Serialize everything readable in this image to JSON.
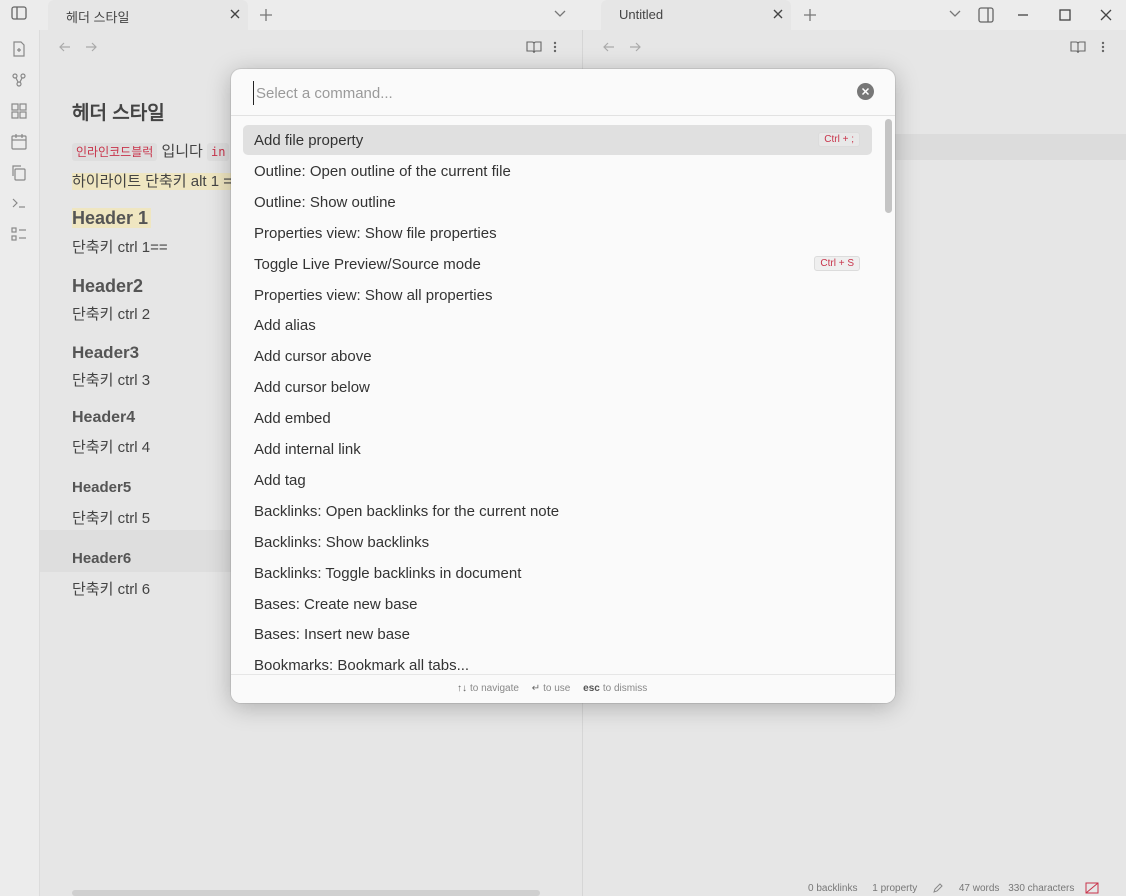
{
  "left_pane": {
    "tab_title": "헤더 스타일",
    "document": {
      "title": "헤더 스타일",
      "line1_code": "인라인코드블럭",
      "line1_text": " 입니다 ",
      "line1_code2": "in",
      "line2_highlight": "하이라이트 단축키 alt 1 ==",
      "header1": "Header 1",
      "header1_note": "단축키 ctrl 1==",
      "header2": "Header2",
      "header2_note": "단축키 ctrl 2",
      "header3": "Header3",
      "header3_note": "단축키 ctrl 3",
      "header4": "Header4",
      "header4_note": "단축키 ctrl 4",
      "header5": "Header5",
      "header5_note": "단축키 ctrl 5",
      "header6": "Header6",
      "header6_note": "단축키 ctrl 6"
    }
  },
  "right_pane": {
    "tab_title": "Untitled"
  },
  "command_palette": {
    "placeholder": "Select a command...",
    "items": [
      {
        "label": "Add file property",
        "hotkey": "Ctrl + ;"
      },
      {
        "label": "Outline: Open outline of the current file"
      },
      {
        "label": "Outline: Show outline"
      },
      {
        "label": "Properties view: Show file properties"
      },
      {
        "label": "Toggle Live Preview/Source mode",
        "hotkey": "Ctrl + S"
      },
      {
        "label": "Properties view: Show all properties"
      },
      {
        "label": "Add alias"
      },
      {
        "label": "Add cursor above"
      },
      {
        "label": "Add cursor below"
      },
      {
        "label": "Add embed"
      },
      {
        "label": "Add internal link"
      },
      {
        "label": "Add tag"
      },
      {
        "label": "Backlinks: Open backlinks for the current note"
      },
      {
        "label": "Backlinks: Show backlinks"
      },
      {
        "label": "Backlinks: Toggle backlinks in document"
      },
      {
        "label": "Bases: Create new base"
      },
      {
        "label": "Bases: Insert new base"
      },
      {
        "label": "Bookmarks: Bookmark all tabs..."
      }
    ],
    "footer": {
      "navigate_keys": "↑↓",
      "navigate_label": "to navigate",
      "use_key": "↵",
      "use_label": "to use",
      "dismiss_key": "esc",
      "dismiss_label": "to dismiss"
    }
  },
  "status_bar": {
    "backlinks": "0 backlinks",
    "properties": "1 property",
    "words": "47 words",
    "characters": "330 characters"
  },
  "colors": {
    "accent_code": "#c8334a",
    "highlight": "#efe6c1"
  }
}
